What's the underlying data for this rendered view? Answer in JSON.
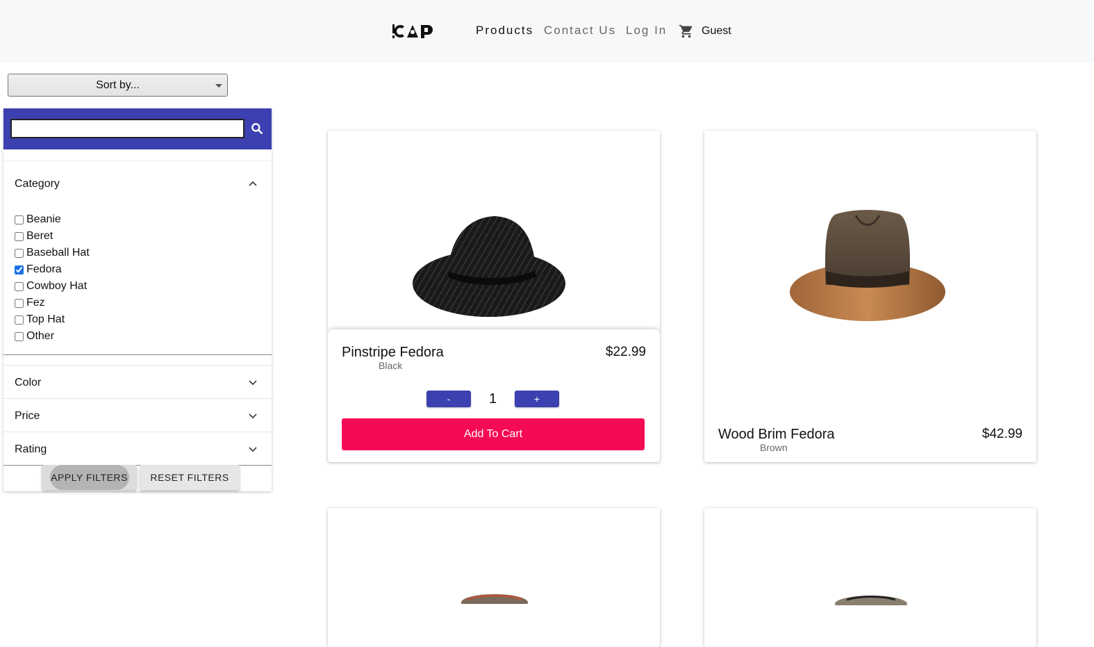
{
  "header": {
    "logo_text": "!CÂP",
    "nav": [
      "Products",
      "Contact Us",
      "Log In"
    ],
    "user": "Guest"
  },
  "sort": {
    "label": "Sort by..."
  },
  "filters": {
    "search_placeholder": "",
    "category": {
      "title": "Category",
      "items": [
        {
          "label": "Beanie",
          "checked": false
        },
        {
          "label": "Beret",
          "checked": false
        },
        {
          "label": "Baseball Hat",
          "checked": false
        },
        {
          "label": "Fedora",
          "checked": true
        },
        {
          "label": "Cowboy Hat",
          "checked": false
        },
        {
          "label": "Fez",
          "checked": false
        },
        {
          "label": "Top Hat",
          "checked": false
        },
        {
          "label": "Other",
          "checked": false
        }
      ]
    },
    "sections": [
      "Color",
      "Price",
      "Rating"
    ],
    "apply_label": "APPLY FILTERS",
    "reset_label": "RESET FILTERS"
  },
  "products": [
    {
      "name": "Pinstripe Fedora",
      "color": "Black",
      "price": "$22.99",
      "quantity": "1",
      "minus": "-",
      "plus": "+",
      "add_to_cart": "Add To Cart"
    },
    {
      "name": "Wood Brim Fedora",
      "color": "Brown",
      "price": "$42.99"
    }
  ],
  "colors": {
    "accent": "#3c40b1",
    "cta": "#f50a54"
  }
}
